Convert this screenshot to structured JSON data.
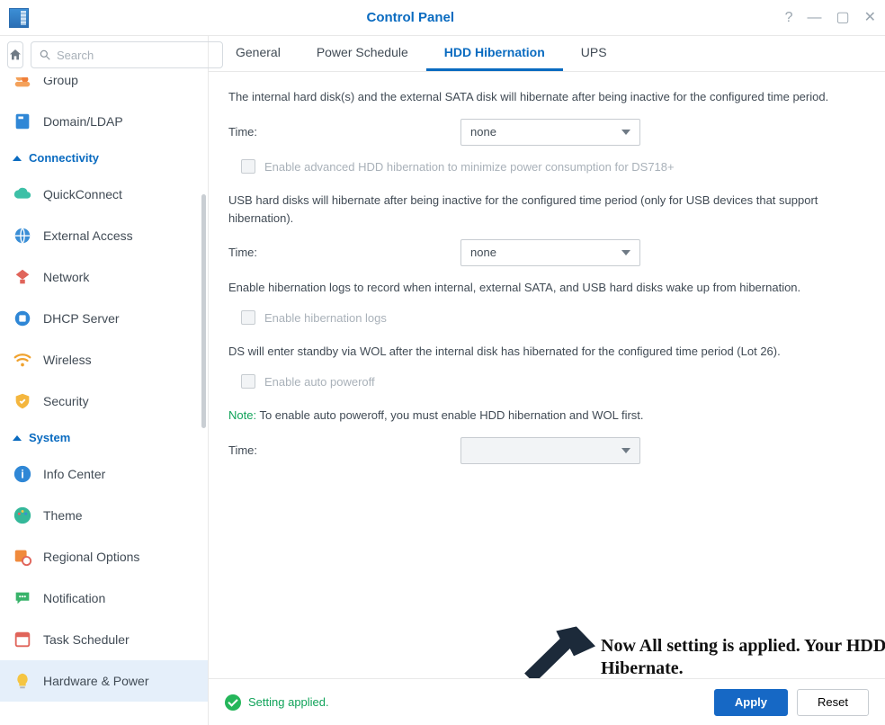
{
  "window": {
    "title": "Control Panel"
  },
  "search": {
    "placeholder": "Search"
  },
  "sidebar": {
    "top_partial": {
      "label": "Group"
    },
    "items_a": [
      {
        "label": "Domain/LDAP"
      }
    ],
    "section_conn": "Connectivity",
    "items_b": [
      {
        "label": "QuickConnect"
      },
      {
        "label": "External Access"
      },
      {
        "label": "Network"
      },
      {
        "label": "DHCP Server"
      },
      {
        "label": "Wireless"
      },
      {
        "label": "Security"
      }
    ],
    "section_sys": "System",
    "items_c": [
      {
        "label": "Info Center"
      },
      {
        "label": "Theme"
      },
      {
        "label": "Regional Options"
      },
      {
        "label": "Notification"
      },
      {
        "label": "Task Scheduler"
      },
      {
        "label": "Hardware & Power"
      }
    ]
  },
  "tabs": {
    "general": "General",
    "power_schedule": "Power Schedule",
    "hdd_hibernation": "HDD Hibernation",
    "ups": "UPS"
  },
  "content": {
    "internal_desc": "The internal hard disk(s) and the external SATA disk will hibernate after being inactive for the configured time period.",
    "time_label": "Time:",
    "time1_value": "none",
    "adv_hib_label": "Enable advanced HDD hibernation to minimize power consumption for DS718+",
    "usb_desc": "USB hard disks will hibernate after being inactive for the configured time period (only for USB devices that support hibernation).",
    "time2_value": "none",
    "logs_desc": "Enable hibernation logs to record when internal, external SATA, and USB hard disks wake up from hibernation.",
    "logs_label": "Enable hibernation logs",
    "standby_desc": "DS will enter standby via WOL after the internal disk has hibernated for the configured time period (Lot 26).",
    "auto_poweroff_label": "Enable auto poweroff",
    "note_prefix": "Note:",
    "note_body": " To enable auto poweroff, you must enable HDD hibernation and WOL first.",
    "time3_value": ""
  },
  "footer": {
    "status": "Setting applied.",
    "apply": "Apply",
    "reset": "Reset"
  },
  "overlay": {
    "caption": "Now All setting is applied. Your HDD or SSD will never Hibernate."
  }
}
